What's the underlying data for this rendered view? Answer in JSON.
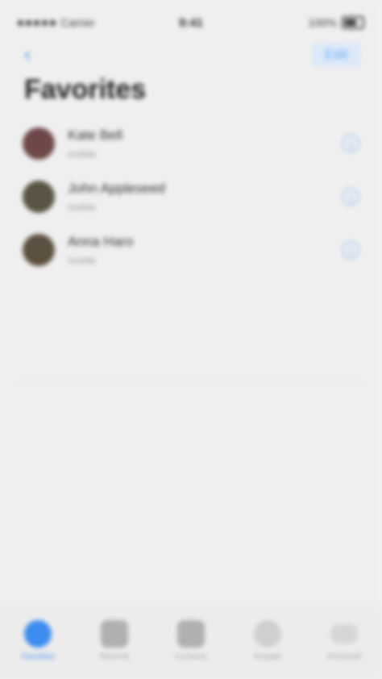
{
  "status_bar": {
    "carrier": "Carrier",
    "time": "9:41",
    "battery": "100%"
  },
  "nav": {
    "back_label": "‹",
    "edit_label": "Edit"
  },
  "title": "Favorites",
  "favorites": [
    {
      "name": "Kate Bell",
      "subtitle": "mobile",
      "avatar_color": "#6e4848"
    },
    {
      "name": "John Appleseed",
      "subtitle": "mobile",
      "avatar_color": "#5a5444"
    },
    {
      "name": "Anna Haro",
      "subtitle": "mobile",
      "avatar_color": "#5c5040"
    }
  ],
  "info_glyph": "i",
  "tabs": [
    {
      "label": "Favorites",
      "icon": "star-icon",
      "active": true
    },
    {
      "label": "Recents",
      "icon": "clock-icon",
      "active": false
    },
    {
      "label": "Contacts",
      "icon": "person-icon",
      "active": false
    },
    {
      "label": "Keypad",
      "icon": "keypad-icon",
      "active": false
    },
    {
      "label": "Voicemail",
      "icon": "voicemail-icon",
      "active": false
    }
  ],
  "colors": {
    "accent": "#3d8cf0",
    "background": "#efefef"
  }
}
